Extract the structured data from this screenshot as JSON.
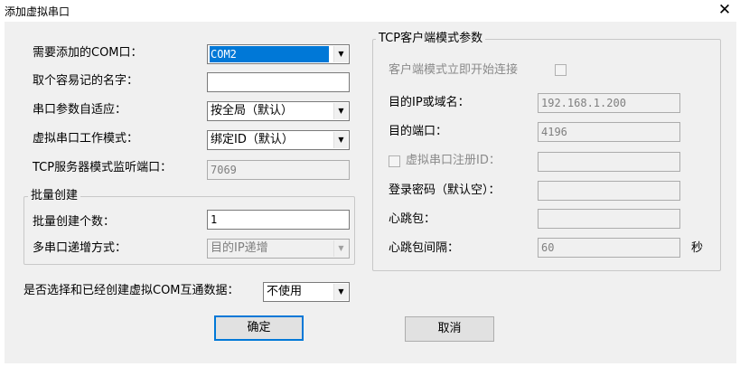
{
  "window": {
    "title": "添加虚拟串口",
    "close_glyph": "✕"
  },
  "left": {
    "com_port": {
      "label": "需要添加的COM口：",
      "value": "COM2"
    },
    "friendly_name": {
      "label": "取个容易记的名字：",
      "value": ""
    },
    "serial_adapt": {
      "label": "串口参数自适应：",
      "value": "按全局（默认）"
    },
    "work_mode": {
      "label": "虚拟串口工作模式：",
      "value": "绑定ID（默认）"
    },
    "tcp_server_port": {
      "label": "TCP服务器模式监听端口：",
      "value": "7069"
    }
  },
  "batch": {
    "title": "批量创建",
    "count": {
      "label": "批量创建个数：",
      "value": "1"
    },
    "increment": {
      "label": "多串口递增方式：",
      "value": "目的IP递增"
    }
  },
  "interconnect": {
    "label": "是否选择和已经创建虚拟COM互通数据：",
    "value": "不使用"
  },
  "tcp_client": {
    "title": "TCP客户端模式参数",
    "auto_connect_label": "客户端模式立即开始连接",
    "target_ip": {
      "label": "目的IP或域名：",
      "value": "192.168.1.200"
    },
    "target_port": {
      "label": "目的端口：",
      "value": "4196"
    },
    "register_id": {
      "label": "虚拟串口注册ID：",
      "value": ""
    },
    "login_password": {
      "label": "登录密码（默认空）：",
      "value": ""
    },
    "heartbeat": {
      "label": "心跳包：",
      "value": ""
    },
    "heartbeat_interval": {
      "label": "心跳包间隔：",
      "value": "60",
      "unit": "秒"
    }
  },
  "buttons": {
    "ok": "确定",
    "cancel": "取消"
  }
}
